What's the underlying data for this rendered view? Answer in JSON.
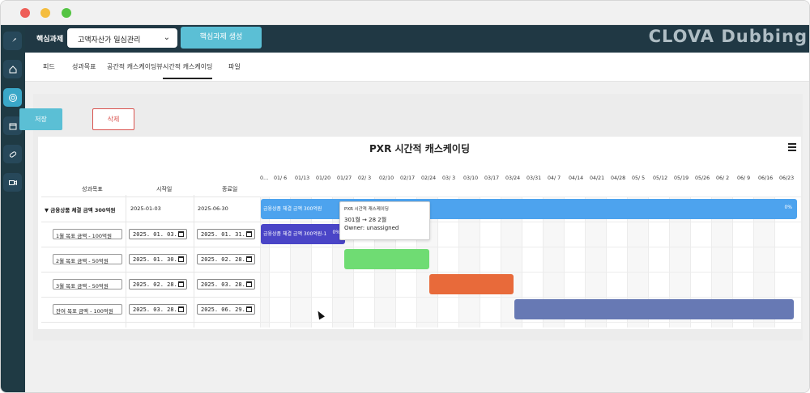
{
  "window": {
    "watermark": "CLOVA Dubbing"
  },
  "topbar": {
    "brand": "핵심과제",
    "select_value": "고액자산가 일심관리",
    "create_button": "핵심과제 생성"
  },
  "tabs": [
    {
      "label": "피드"
    },
    {
      "label": "성과목표"
    },
    {
      "label": "공간적 캐스케이딩뷰"
    },
    {
      "label": "시간적 캐스케이딩"
    },
    {
      "label": "파일"
    }
  ],
  "actions": {
    "save": "저장",
    "delete": "삭제"
  },
  "gantt": {
    "title": "PXR 시간적 캐스케이딩",
    "headers": {
      "goal": "성과목표",
      "start": "시작일",
      "end": "종료일"
    },
    "ticks": [
      "0…",
      "01/ 6",
      "01/13",
      "01/20",
      "01/27",
      "02/ 3",
      "02/10",
      "02/17",
      "02/24",
      "03/ 3",
      "03/10",
      "03/17",
      "03/24",
      "03/31",
      "04/ 7",
      "04/14",
      "04/21",
      "04/28",
      "05/ 5",
      "05/12",
      "05/19",
      "05/26",
      "06/ 2",
      "06/ 9",
      "06/16",
      "06/23"
    ],
    "rows": [
      {
        "name": "▼ 금융상품 체결 금액 300억원",
        "start": "2025-01-03",
        "end": "2025-06-30",
        "bar_label": "금융상품 체결 금액 300억원",
        "pct": "0%",
        "color": "#4da3ee"
      },
      {
        "name": "1월 목표 금액 - 100억원",
        "start": "2025. 01. 03.",
        "end": "2025. 01. 31.",
        "bar_label": "금융상품 체결 금액 300억원-1",
        "pct": "0%",
        "color": "#4a45c7"
      },
      {
        "name": "2월 목표 금액 - 50억원",
        "start": "2025. 01. 30.",
        "end": "2025. 02. 28.",
        "bar_label": "",
        "pct": "",
        "color": "#6fdc73"
      },
      {
        "name": "3월 목표 금액 - 50억원",
        "start": "2025. 02. 28.",
        "end": "2025. 03. 28.",
        "bar_label": "",
        "pct": "",
        "color": "#e86a3a"
      },
      {
        "name": "잔여 목표 금액 - 100억원",
        "start": "2025. 03. 28.",
        "end": "2025. 06. 29.",
        "bar_label": "",
        "pct": "",
        "color": "#6779b4"
      }
    ],
    "tooltip": {
      "title": "PXR 시간적 캐스케이딩",
      "line1": "301월 → 28 2월",
      "line2": "Owner: unassigned"
    }
  }
}
